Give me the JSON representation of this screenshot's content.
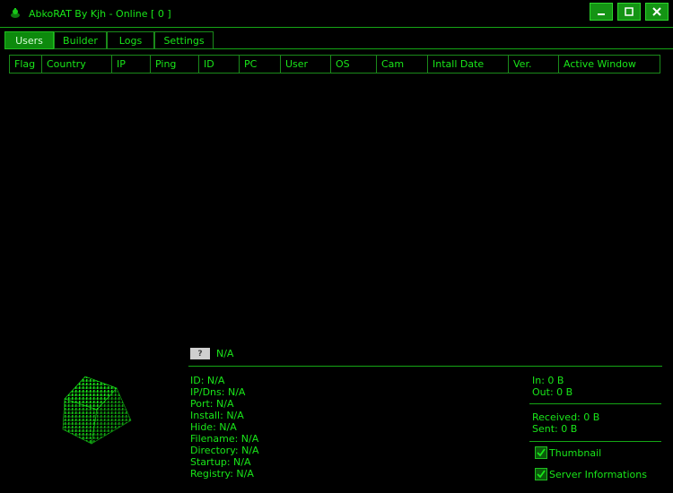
{
  "window": {
    "title": "AbkoRAT By Kjh - Online [ 0 ]",
    "controls": {
      "minimize": "_",
      "maximize": "☐",
      "close": "✕"
    }
  },
  "tabs": [
    {
      "label": "Users",
      "active": true
    },
    {
      "label": "Builder"
    },
    {
      "label": "Logs"
    },
    {
      "label": "Settings"
    }
  ],
  "grid": {
    "columns": [
      "Flag",
      "Country",
      "IP",
      "Ping",
      "ID",
      "PC",
      "User",
      "OS",
      "Cam",
      "Intall Date",
      "Ver.",
      "Active Window"
    ]
  },
  "status": {
    "flag_placeholder": "?",
    "country": "N/A"
  },
  "details": {
    "id": "ID: N/A",
    "ip": "IP/Dns: N/A",
    "port": "Port: N/A",
    "install": "Install: N/A",
    "hide": "Hide: N/A",
    "filename": "Filename: N/A",
    "directory": "Directory: N/A",
    "startup": "Startup: N/A",
    "registry": "Registry: N/A"
  },
  "traffic": {
    "in": "In: 0 B",
    "out": "Out: 0 B",
    "received": "Received: 0 B",
    "sent": "Sent: 0 B"
  },
  "options": {
    "thumbnail": {
      "label": "Thumbnail",
      "checked": true
    },
    "server_info": {
      "label": "Server Informations",
      "checked": true
    }
  },
  "colors": {
    "accent": "#19e619",
    "button": "#149414",
    "background": "#000000"
  }
}
